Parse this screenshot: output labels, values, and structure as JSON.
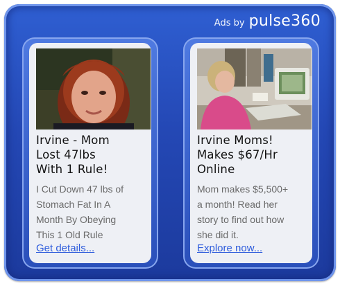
{
  "header": {
    "ads_by_label": "Ads by",
    "brand": "pulse360"
  },
  "ads": [
    {
      "headline_lines": [
        "Irvine - Mom",
        "Lost 47lbs",
        "With 1 Rule!"
      ],
      "description_lines": [
        "I Cut Down 47 lbs of",
        "Stomach Fat In A",
        "Month By Obeying",
        "This 1 Old Rule"
      ],
      "cta": "Get details..."
    },
    {
      "headline_lines": [
        "Irvine Moms!",
        "Makes $67/Hr",
        "Online"
      ],
      "description_lines": [
        "Mom makes $5,500+",
        "a month! Read her",
        "story to find out how",
        "she did it."
      ],
      "cta": "Explore now..."
    }
  ],
  "colors": {
    "frame_blue": "#2448b5",
    "card_bg": "#eef0f5",
    "link_blue": "#2f5ddc",
    "desc_gray": "#6a6a6a"
  }
}
